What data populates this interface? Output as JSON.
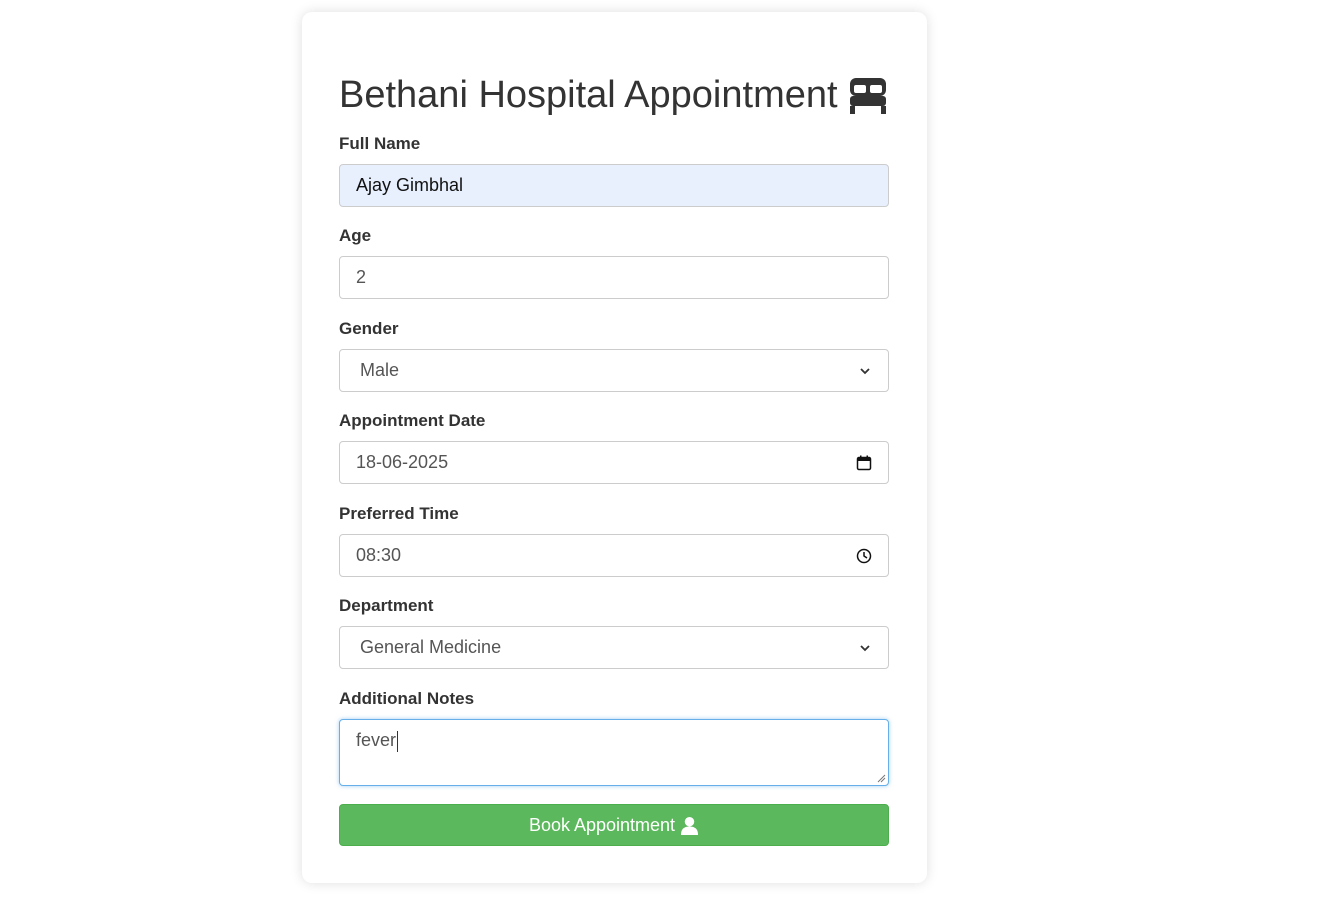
{
  "form": {
    "title": "Bethani Hospital Appointment",
    "title_icon": "bed-icon",
    "fields": {
      "full_name": {
        "label": "Full Name",
        "value": "Ajay Gimbhal"
      },
      "age": {
        "label": "Age",
        "value": "2"
      },
      "gender": {
        "label": "Gender",
        "value": "Male",
        "icon": "chevron-down-icon"
      },
      "appointment_date": {
        "label": "Appointment Date",
        "value": "18-06-2025",
        "icon": "calendar-icon"
      },
      "preferred_time": {
        "label": "Preferred Time",
        "value": "08:30",
        "icon": "clock-icon"
      },
      "department": {
        "label": "Department",
        "value": "General Medicine",
        "icon": "chevron-down-icon"
      },
      "notes": {
        "label": "Additional Notes",
        "value": "fever"
      }
    },
    "submit": {
      "label": "Book Appointment",
      "icon": "user-icon"
    }
  },
  "colors": {
    "button": "#5cb85c",
    "autofill": "#e8f0fe",
    "focus_border": "#66afe9",
    "text": "#333333"
  }
}
